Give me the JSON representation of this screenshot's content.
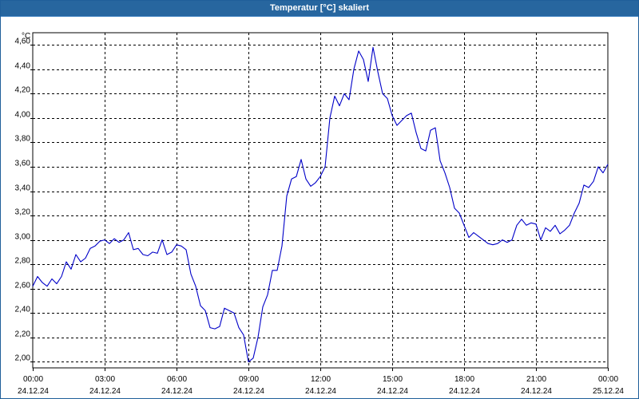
{
  "window": {
    "title": "Temperatur [°C] skaliert"
  },
  "colors": {
    "line": "#0000c8",
    "grid": "#000000",
    "titlebar": "#27669f",
    "title_text": "#ffffff"
  },
  "chart_data": {
    "type": "line",
    "title": "Temperatur [°C] skaliert",
    "ylabel": "°C",
    "xlabel": "",
    "ylim": [
      1.95,
      4.7
    ],
    "xlim": [
      0,
      24
    ],
    "grid": true,
    "legend": "none",
    "y_ticks": [
      "2,00",
      "2,20",
      "2,40",
      "2,60",
      "2,80",
      "3,00",
      "3,20",
      "3,40",
      "3,60",
      "3,80",
      "4,00",
      "4,20",
      "4,40",
      "4,60"
    ],
    "y_tick_values": [
      2.0,
      2.2,
      2.4,
      2.6,
      2.8,
      3.0,
      3.2,
      3.4,
      3.6,
      3.8,
      4.0,
      4.2,
      4.4,
      4.6
    ],
    "x_ticks": [
      {
        "time": "00:00",
        "date": "24.12.24"
      },
      {
        "time": "03:00",
        "date": "24.12.24"
      },
      {
        "time": "06:00",
        "date": "24.12.24"
      },
      {
        "time": "09:00",
        "date": "24.12.24"
      },
      {
        "time": "12:00",
        "date": "24.12.24"
      },
      {
        "time": "15:00",
        "date": "24.12.24"
      },
      {
        "time": "18:00",
        "date": "24.12.24"
      },
      {
        "time": "21:00",
        "date": "24.12.24"
      },
      {
        "time": "00:00",
        "date": "25.12.24"
      }
    ],
    "x_tick_values": [
      0,
      3,
      6,
      9,
      12,
      15,
      18,
      21,
      24
    ],
    "series": [
      {
        "x": [
          0,
          0.2,
          0.4,
          0.6,
          0.8,
          1.0,
          1.2,
          1.4,
          1.6,
          1.8,
          2.0,
          2.2,
          2.4,
          2.6,
          2.8,
          3.0,
          3.2,
          3.4,
          3.6,
          3.8,
          4.0,
          4.2,
          4.4,
          4.6,
          4.8,
          5.0,
          5.2,
          5.4,
          5.6,
          5.8,
          6.0,
          6.2,
          6.4,
          6.6,
          6.8,
          7.0,
          7.2,
          7.4,
          7.6,
          7.8,
          8.0,
          8.2,
          8.4,
          8.6,
          8.8,
          9.0,
          9.2,
          9.4,
          9.6,
          9.8,
          10.0,
          10.2,
          10.4,
          10.6,
          10.8,
          11.0,
          11.2,
          11.4,
          11.6,
          11.8,
          12.0,
          12.2,
          12.4,
          12.6,
          12.8,
          13.0,
          13.2,
          13.4,
          13.6,
          13.8,
          14.0,
          14.2,
          14.4,
          14.6,
          14.8,
          15.0,
          15.2,
          15.4,
          15.6,
          15.8,
          16.0,
          16.2,
          16.4,
          16.6,
          16.8,
          17.0,
          17.2,
          17.4,
          17.6,
          17.8,
          18.0,
          18.2,
          18.4,
          18.6,
          18.8,
          19.0,
          19.2,
          19.4,
          19.6,
          19.8,
          20.0,
          20.2,
          20.4,
          20.6,
          20.8,
          21.0,
          21.2,
          21.4,
          21.6,
          21.8,
          22.0,
          22.2,
          22.4,
          22.6,
          22.8,
          23.0,
          23.2,
          23.4,
          23.6,
          23.8,
          24.0
        ],
        "y": [
          2.62,
          2.7,
          2.65,
          2.62,
          2.68,
          2.64,
          2.7,
          2.82,
          2.76,
          2.88,
          2.82,
          2.85,
          2.93,
          2.95,
          2.99,
          3.0,
          2.97,
          3.01,
          2.98,
          3.0,
          3.06,
          2.92,
          2.93,
          2.88,
          2.87,
          2.9,
          2.89,
          3.0,
          2.88,
          2.9,
          2.96,
          2.95,
          2.92,
          2.72,
          2.62,
          2.46,
          2.42,
          2.28,
          2.27,
          2.29,
          2.44,
          2.42,
          2.4,
          2.28,
          2.22,
          2.0,
          2.03,
          2.2,
          2.45,
          2.55,
          2.75,
          2.75,
          2.95,
          3.36,
          3.5,
          3.52,
          3.66,
          3.5,
          3.44,
          3.47,
          3.52,
          3.6,
          4.0,
          4.18,
          4.1,
          4.2,
          4.15,
          4.4,
          4.55,
          4.48,
          4.3,
          4.58,
          4.38,
          4.2,
          4.16,
          4.02,
          3.94,
          3.98,
          4.02,
          4.04,
          3.88,
          3.75,
          3.73,
          3.9,
          3.92,
          3.65,
          3.55,
          3.43,
          3.26,
          3.22,
          3.12,
          3.02,
          3.06,
          3.03,
          3.0,
          2.97,
          2.96,
          2.97,
          3.0,
          2.98,
          3.0,
          3.12,
          3.17,
          3.12,
          3.14,
          3.13,
          3.0,
          3.1,
          3.07,
          3.12,
          3.05,
          3.08,
          3.12,
          3.22,
          3.3,
          3.45,
          3.43,
          3.48,
          3.6,
          3.55,
          3.62
        ]
      }
    ]
  }
}
